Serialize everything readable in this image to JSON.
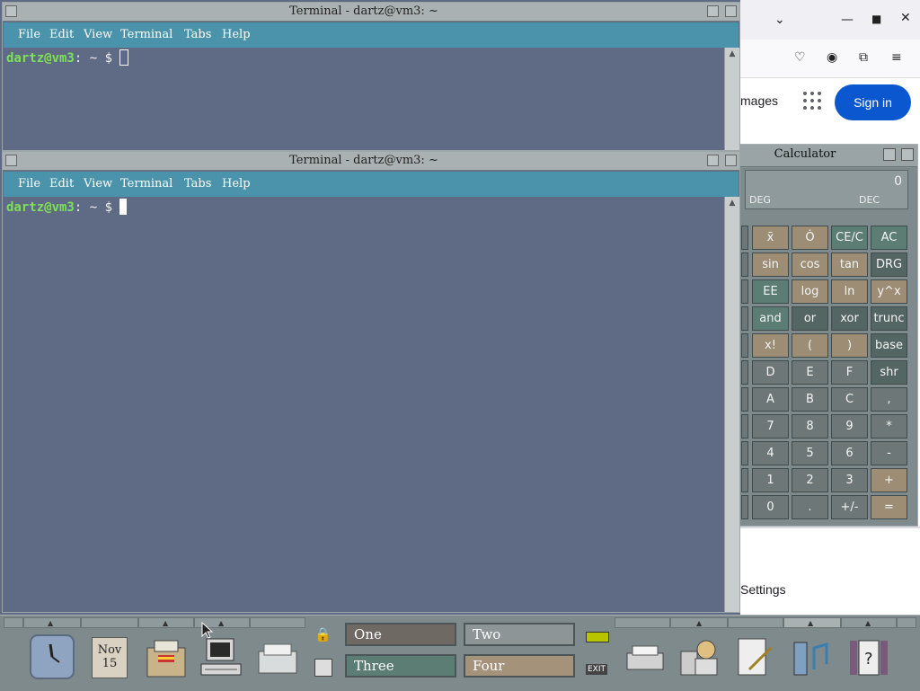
{
  "browser": {
    "images_text": "mages",
    "signin_label": "Sign in",
    "settings_text": "Settings"
  },
  "calculator": {
    "title": "Calculator",
    "display_value": "0",
    "angle_mode": "DEG",
    "base_mode": "DEC",
    "rows": [
      [
        "x̄",
        "Ȯ",
        "CE/C",
        "AC"
      ],
      [
        "sin",
        "cos",
        "tan",
        "DRG"
      ],
      [
        "EE",
        "log",
        "ln",
        "y^x"
      ],
      [
        "and",
        "or",
        "xor",
        "trunc"
      ],
      [
        "x!",
        "(",
        ")",
        "base"
      ],
      [
        "D",
        "E",
        "F",
        "shr"
      ],
      [
        "A",
        "B",
        "C",
        ","
      ],
      [
        "7",
        "8",
        "9",
        "*"
      ],
      [
        "4",
        "5",
        "6",
        "-"
      ],
      [
        "1",
        "2",
        "3",
        "+"
      ],
      [
        "0",
        ".",
        "+/-",
        "="
      ]
    ]
  },
  "terminals": [
    {
      "title": "Terminal - dartz@vm3: ~",
      "menu": [
        "File",
        "Edit",
        "View",
        "Terminal",
        "Tabs",
        "Help"
      ],
      "prompt_user": "dartz@vm3",
      "prompt_rest": ": ~ $ "
    },
    {
      "title": "Terminal - dartz@vm3: ~",
      "menu": [
        "File",
        "Edit",
        "View",
        "Terminal",
        "Tabs",
        "Help"
      ],
      "prompt_user": "dartz@vm3",
      "prompt_rest": ": ~ $ "
    }
  ],
  "panel": {
    "calendar_month": "Nov",
    "calendar_day": "15",
    "workspaces": [
      "One",
      "Two",
      "Three",
      "Four"
    ],
    "exit_label": "EXIT"
  },
  "colors": {
    "terminal_bg": "#5f6b85",
    "menubar": "#4a93aa",
    "prompt_user": "#7ee05a",
    "signin_bg": "#0b57d0"
  }
}
